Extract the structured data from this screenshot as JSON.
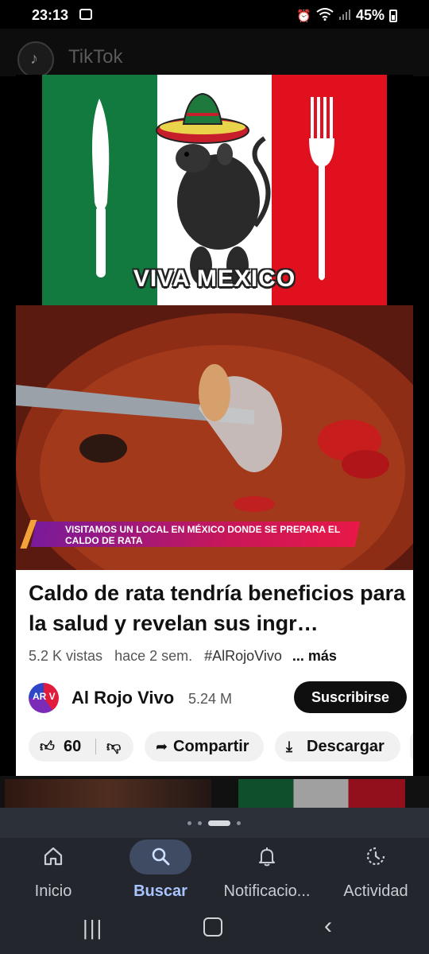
{
  "status_bar": {
    "time": "23:13",
    "battery": "45%",
    "icons": [
      "image-icon",
      "alarm-icon",
      "wifi-icon",
      "signal-icon",
      "battery-icon"
    ]
  },
  "app_header": {
    "title": "TikTok",
    "icon": "tiktok-logo-icon"
  },
  "thumbnail": {
    "banner_text": "VIVA MEXICO",
    "lower_third": "VISITAMOS UN LOCAL EN MÉXICO DONDE SE PREPARA EL CALDO DE RATA",
    "colors": {
      "green": "#137a3f",
      "white": "#ffffff",
      "red": "#e0101f"
    }
  },
  "video": {
    "title": "Caldo de rata tendría beneficios para la salud y revelan sus ingr…",
    "views": "5.2 K vistas",
    "age": "hace 2 sem.",
    "hashtag": "#AlRojoVivo",
    "more": "... más"
  },
  "channel": {
    "avatar_text": "AR V",
    "name": "Al Rojo Vivo",
    "subscribers": "5.24 M",
    "subscribe_label": "Suscribirse"
  },
  "actions": {
    "likes": "60",
    "share": "Compartir",
    "download": "Descargar"
  },
  "bottom_nav": {
    "items": [
      {
        "label": "Inicio",
        "icon": "home-icon",
        "active": false
      },
      {
        "label": "Buscar",
        "icon": "search-icon",
        "active": true
      },
      {
        "label": "Notificacio...",
        "icon": "bell-icon",
        "active": false
      },
      {
        "label": "Actividad",
        "icon": "activity-icon",
        "active": false
      }
    ]
  }
}
